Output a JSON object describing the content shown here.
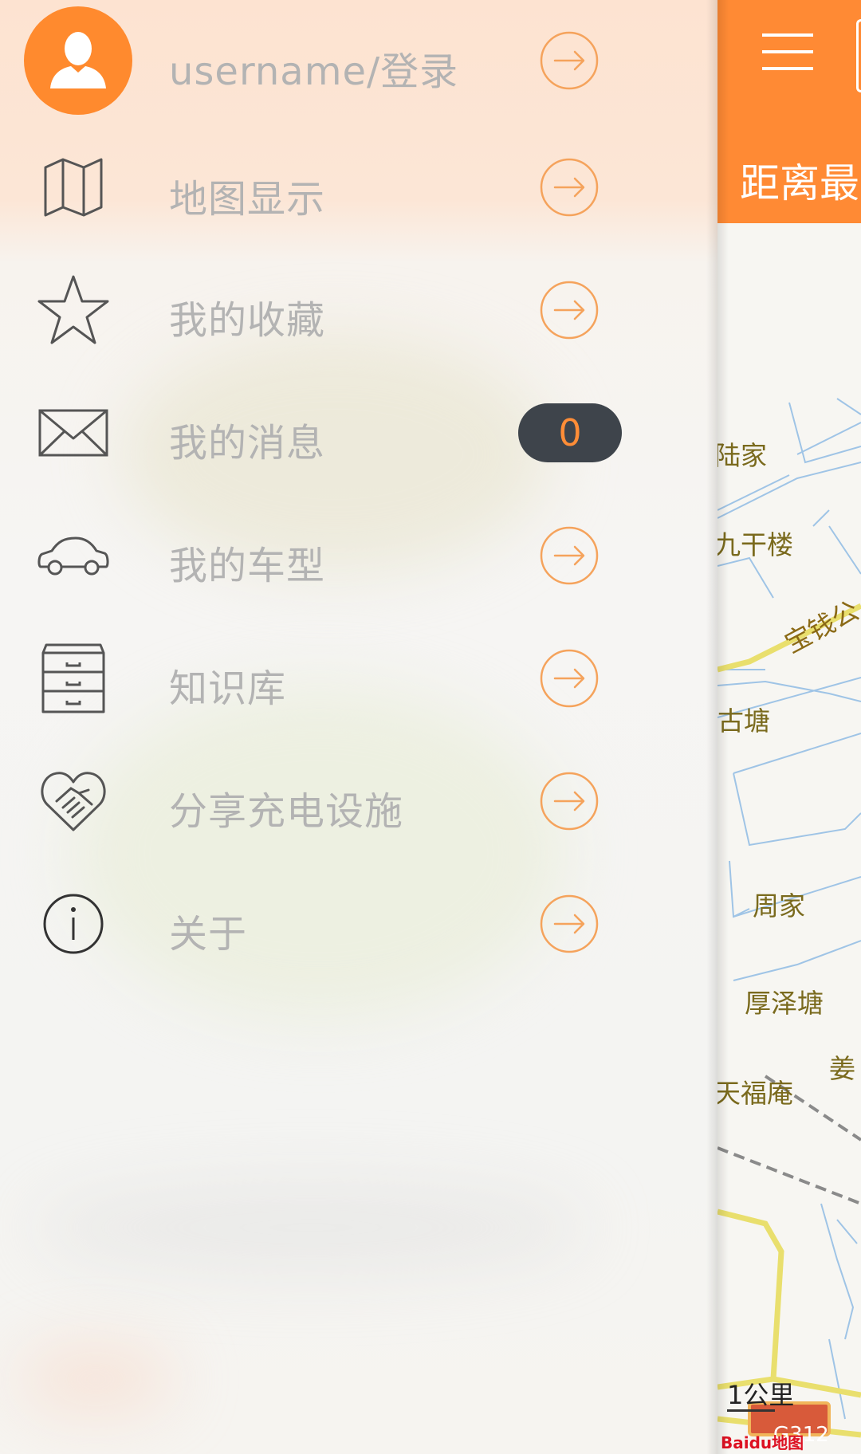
{
  "drawer": {
    "user": {
      "label": "username/登录",
      "icon": "user-icon"
    },
    "items": [
      {
        "label": "地图显示",
        "icon": "map-icon"
      },
      {
        "label": "我的收藏",
        "icon": "star-icon"
      },
      {
        "label": "我的消息",
        "icon": "envelope-icon",
        "badge": "0"
      },
      {
        "label": "我的车型",
        "icon": "car-icon"
      },
      {
        "label": "知识库",
        "icon": "drawers-icon"
      },
      {
        "label": "分享充电设施",
        "icon": "heart-handshake-icon"
      },
      {
        "label": "关于",
        "icon": "info-icon"
      }
    ]
  },
  "map": {
    "header_title": "距离最",
    "places": [
      "陆家",
      "九干楼",
      "宝钱公",
      "古塘",
      "周家",
      "厚泽塘",
      "姜",
      "天福庵"
    ],
    "scale": "1公里",
    "road_badge": "G312",
    "logo": "Baidu地图"
  },
  "colors": {
    "accent": "#ff8a34",
    "badge_bg": "#3e444b",
    "label_gray": "#b3b3b3"
  }
}
